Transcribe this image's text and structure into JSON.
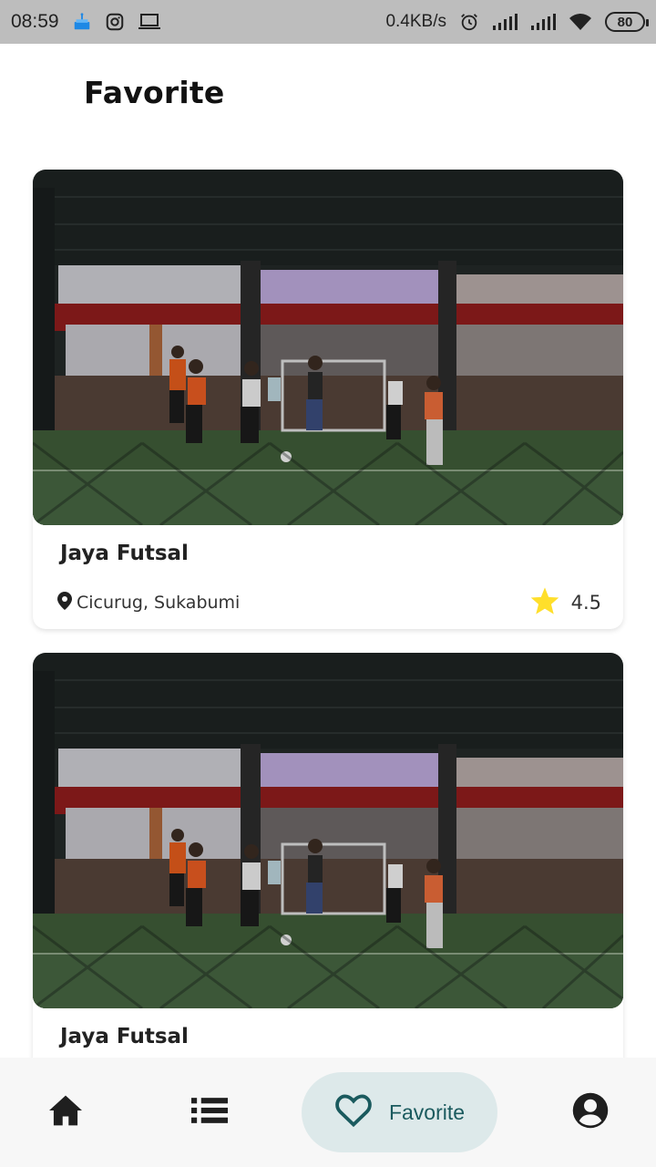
{
  "status_bar": {
    "time": "08:59",
    "network_speed": "0.4KB/s",
    "battery": "80",
    "icons": [
      "cake-icon",
      "instagram-icon",
      "laptop-icon",
      "alarm-icon",
      "signal-icon",
      "signal-icon",
      "wifi-icon",
      "battery-icon"
    ]
  },
  "header": {
    "title": "Favorite"
  },
  "favorites": [
    {
      "name": "Jaya Futsal",
      "location": "Cicurug, Sukabumi",
      "rating": "4.5",
      "image": "futsal-court-photo"
    },
    {
      "name": "Jaya Futsal",
      "image": "futsal-court-photo"
    }
  ],
  "bottom_nav": {
    "items": [
      {
        "icon": "home-icon",
        "label": ""
      },
      {
        "icon": "list-icon",
        "label": ""
      },
      {
        "icon": "heart-icon",
        "label": "Favorite",
        "active": true
      },
      {
        "icon": "account-circle-icon",
        "label": ""
      }
    ]
  },
  "colors": {
    "status_bar": "#bdbdbd",
    "active_tab_bg": "#dde9ea",
    "active_tab_fg": "#1a5a5e",
    "star": "#ffdf2b"
  }
}
